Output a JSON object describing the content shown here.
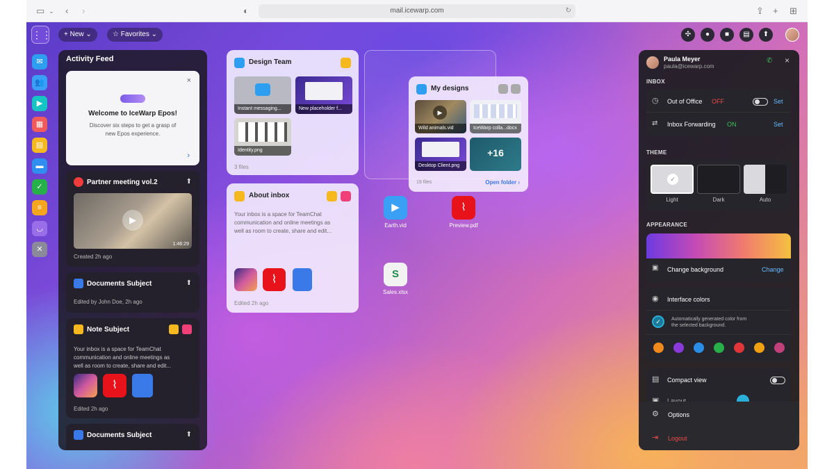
{
  "browser": {
    "url": "mail.icewarp.com"
  },
  "topbar": {
    "new_label": "New",
    "favorites_label": "Favorites"
  },
  "feed": {
    "title": "Activity Feed",
    "welcome": {
      "title": "Welcome to IceWarp Epos!",
      "text_line1": "Discover six steps to get a grasp of",
      "text_line2": "new Epos experience."
    },
    "partner": {
      "title": "Partner meeting vol.2",
      "duration": "1:46:29",
      "meta": "Created 2h ago"
    },
    "docs1": {
      "title": "Documents Subject",
      "meta": "Edited by John Doe, 2h ago"
    },
    "note": {
      "title": "Note Subject",
      "line1": "Your inbox is a space for TeamChat",
      "line2": "communication and online meetings as",
      "line3": "well as room to create, share and edit...",
      "meta": "Edited 2h ago"
    },
    "docs2": {
      "title": "Documents Subject"
    }
  },
  "design_team": {
    "title": "Design Team",
    "files": [
      {
        "label": "Instant messaging..."
      },
      {
        "label": "New placeholder f..."
      },
      {
        "label": "Identity.png"
      }
    ],
    "count": "3 files"
  },
  "about_inbox": {
    "title": "About inbox",
    "line1": "Your inbox is a space for TeamChat",
    "line2": "communication and online meetings as",
    "line3": "well as room to create, share and edit...",
    "meta": "Edited 2h ago"
  },
  "my_designs": {
    "title": "My designs",
    "files": [
      {
        "label": "Wild animals.vid"
      },
      {
        "label": "IceWarp colla...docx"
      },
      {
        "label": "Desktop Client.png"
      }
    ],
    "more": "+16",
    "count": "19 files",
    "open": "Open folder"
  },
  "desktop": {
    "earth": "Earth.vid",
    "preview": "Preview.pdf",
    "sales": "Sales.xlsx"
  },
  "panel": {
    "name": "Paula Meyer",
    "email": "paula@icewarp.com",
    "inbox_label": "INBOX",
    "ooo_label": "Out of Office",
    "ooo_state": "OFF",
    "fwd_label": "Inbox Forwarding",
    "fwd_state": "ON",
    "set1": "Set",
    "set2": "Set",
    "theme_label": "THEME",
    "themes": [
      "Light",
      "Dark",
      "Auto"
    ],
    "appearance_label": "APPEARANCE",
    "change_bg": "Change background",
    "change": "Change",
    "interface_colors": "Interface colors",
    "auto_line1": "Automatically generated color from",
    "auto_line2": "the selected background.",
    "swatches": [
      "#f08a1c",
      "#8a3ad8",
      "#2a8ee8",
      "#27b04a",
      "#e0363a",
      "#f0a010",
      "#c0407a"
    ],
    "compact": "Compact view",
    "layout": "Layout",
    "options": "Options",
    "logout": "Logout"
  }
}
